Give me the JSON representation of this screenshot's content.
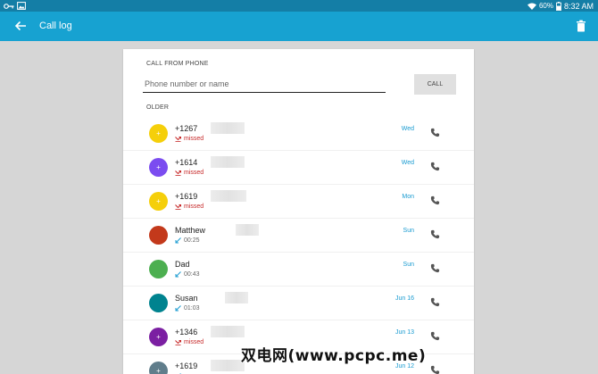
{
  "status_bar": {
    "battery": "60%",
    "time": "8:32 AM",
    "icons": [
      "key-icon",
      "image-icon",
      "wifi-icon",
      "battery-icon"
    ]
  },
  "app_bar": {
    "title": "Call log",
    "back_icon": "arrow-left-icon",
    "action_icon": "trash-icon",
    "color": "#17a2d1"
  },
  "call_from_phone": {
    "label": "CALL FROM PHONE",
    "placeholder": "Phone number or name",
    "value": "",
    "call_button": "CALL"
  },
  "section_label": "OLDER",
  "calls": [
    {
      "name": "+1267",
      "detail": "missed",
      "status": "missed",
      "date": "Wed",
      "avatar_color": "#f5cf0a",
      "avatar_text": "+"
    },
    {
      "name": "+1614",
      "detail": "missed",
      "status": "missed",
      "date": "Wed",
      "avatar_color": "#7b4cf0",
      "avatar_text": "+"
    },
    {
      "name": "+1619",
      "detail": "missed",
      "status": "missed",
      "date": "Mon",
      "avatar_color": "#f5cf0a",
      "avatar_text": "+"
    },
    {
      "name": "Matthew",
      "detail": "00:25",
      "status": "incoming",
      "date": "Sun",
      "avatar_color": "#c3391b",
      "avatar_text": ""
    },
    {
      "name": "Dad",
      "detail": "00:43",
      "status": "incoming",
      "date": "Sun",
      "avatar_color": "#4caf50",
      "avatar_text": ""
    },
    {
      "name": "Susan",
      "detail": "01:03",
      "status": "incoming",
      "date": "Jun 16",
      "avatar_color": "#00838f",
      "avatar_text": ""
    },
    {
      "name": "+1346",
      "detail": "missed",
      "status": "missed",
      "date": "Jun 13",
      "avatar_color": "#7b1fa2",
      "avatar_text": "+"
    },
    {
      "name": "+1619",
      "detail": "",
      "status": "incoming",
      "date": "Jun 12",
      "avatar_color": "#607d8b",
      "avatar_text": "+"
    }
  ],
  "watermark": "双电网(www.pcpc.me)"
}
